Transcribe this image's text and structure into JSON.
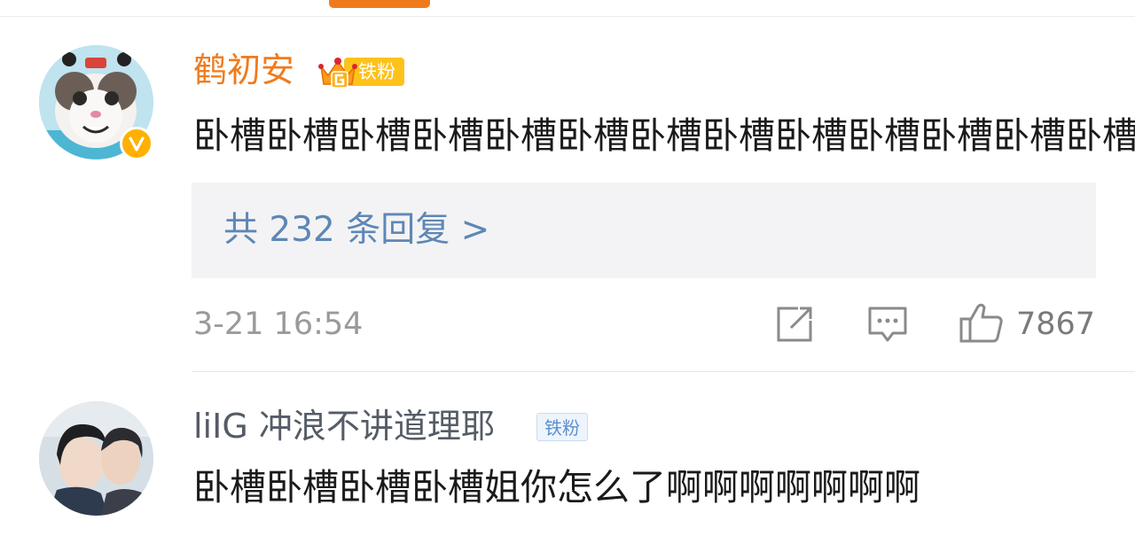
{
  "comments": [
    {
      "username": "鹤初安",
      "badge": "铁粉",
      "text": "卧槽卧槽卧槽卧槽卧槽卧槽卧槽卧槽卧槽卧槽卧槽卧槽卧槽",
      "reply_link": "共 232 条回复 >",
      "timestamp": "3-21 16:54",
      "likes": "7867"
    },
    {
      "username": "liIG 冲浪不讲道理耶",
      "badge": "铁粉",
      "text": "卧槽卧槽卧槽卧槽姐你怎么了啊啊啊啊啊啊啊"
    }
  ],
  "colors": {
    "accent": "#f07b1d",
    "reply_link": "#5e87b5",
    "gold_badge": "#ffc21a",
    "blue_badge": "#5a8fd0",
    "verified": "#ffb000"
  },
  "icons": {
    "share": "share-icon",
    "comment": "comment-icon",
    "like": "thumbs-up-icon",
    "verified": "verified-v-icon",
    "crown": "crown-icon"
  }
}
